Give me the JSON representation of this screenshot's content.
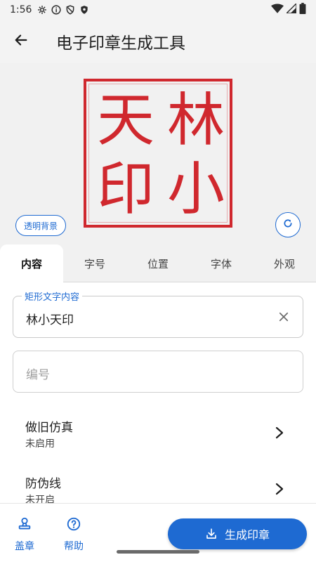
{
  "status_bar": {
    "time": "1:56",
    "icons": [
      "gear-icon",
      "info-icon",
      "shield-icon",
      "shield-filled-icon"
    ],
    "right_icons": [
      "wifi-icon",
      "cell-signal-icon",
      "battery-icon"
    ]
  },
  "app_bar": {
    "title": "电子印章生成工具",
    "back_icon": "arrow-left-icon"
  },
  "preview": {
    "seal_color": "#d0282e",
    "seal_chars": [
      "天",
      "林",
      "印",
      "小"
    ],
    "transparent_bg_label": "透明背景",
    "refresh_icon": "refresh-icon"
  },
  "tabs": [
    {
      "label": "内容",
      "active": true
    },
    {
      "label": "字号",
      "active": false
    },
    {
      "label": "位置",
      "active": false
    },
    {
      "label": "字体",
      "active": false
    },
    {
      "label": "外观",
      "active": false
    }
  ],
  "content": {
    "text_field": {
      "label": "矩形文字内容",
      "value": "林小天印"
    },
    "number_field": {
      "placeholder": "编号"
    },
    "options": [
      {
        "title": "做旧仿真",
        "status": "未启用"
      },
      {
        "title": "防伪线",
        "status": "未开启"
      }
    ]
  },
  "bottom_bar": {
    "nav": [
      {
        "label": "盖章",
        "icon": "stamp-icon"
      },
      {
        "label": "帮助",
        "icon": "help-circle-icon"
      }
    ],
    "generate_button": "生成印章",
    "accent": "#1e6ad2"
  }
}
